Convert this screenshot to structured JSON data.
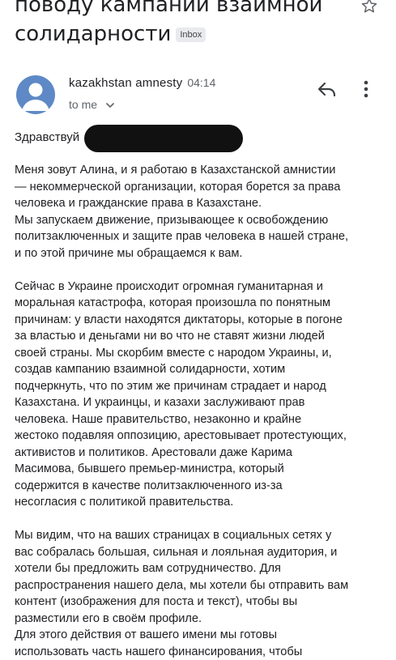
{
  "subject": {
    "line1": "поводу кампании взаимной",
    "line2": "солидарности",
    "label": "Inbox"
  },
  "sender": {
    "name": "kazakhstan amnesty",
    "time": "04:14",
    "to": "to me"
  },
  "body": {
    "greeting": "Здравствуй",
    "lines": [
      "Меня зовут Алина, и я работаю в Казахстанской амнистии",
      "— некоммерческой организации, которая борется за права",
      "человека и гражданские права в Казахстане.",
      "Мы запускаем движение, призывающее к освобождению",
      "политзаключенных и защите прав человека в нашей стране,",
      "и по этой причине мы обращаемся к вам.",
      "",
      "Сейчас в Украине происходит огромная гуманитарная и",
      "моральная катастрофа, которая произошла по понятным",
      "причинам: у власти находятся диктаторы, которые в погоне",
      "за властью и деньгами ни во что не ставят жизни людей",
      "своей страны. Мы скорбим вместе с народом Украины, и,",
      "создав кампанию взаимной солидарности, хотим",
      "подчеркнуть, что по этим же причинам страдает и народ",
      "Казахстана. И украинцы, и казахи заслуживают прав",
      "человека. Наше правительство, незаконно и крайне",
      "жестоко подавляя оппозицию, арестовывает протестующих,",
      "активистов и политиков. Арестовали даже Карима",
      "Масимова, бывшего премьер-министра, который",
      "содержится в качестве политзаключенного из-за",
      "несогласия с политикой правительства.",
      "",
      "Мы видим, что на ваших страницах в социальных сетях у",
      "вас собралась большая, сильная и лояльная аудитория, и",
      "хотели бы предложить вам сотрудничество. Для",
      "распространения нашего дела, мы хотели бы отправить вам",
      "контент (изображения для поста и текст), чтобы вы",
      "разместили его в своём профиле.",
      "Для этого действия от вашего имени мы готовы",
      "использовать часть нашего финансирования, чтобы"
    ]
  },
  "icons": {
    "star": "star-outline-icon",
    "avatar": "person-avatar-icon",
    "reply": "reply-arrow-icon",
    "more": "more-vertical-icon",
    "expand": "chevron-down-icon"
  },
  "colors": {
    "avatar_bg": "#5e89c6",
    "text": "#202124",
    "muted": "#5f6368",
    "badge_bg": "#e8eaed"
  }
}
